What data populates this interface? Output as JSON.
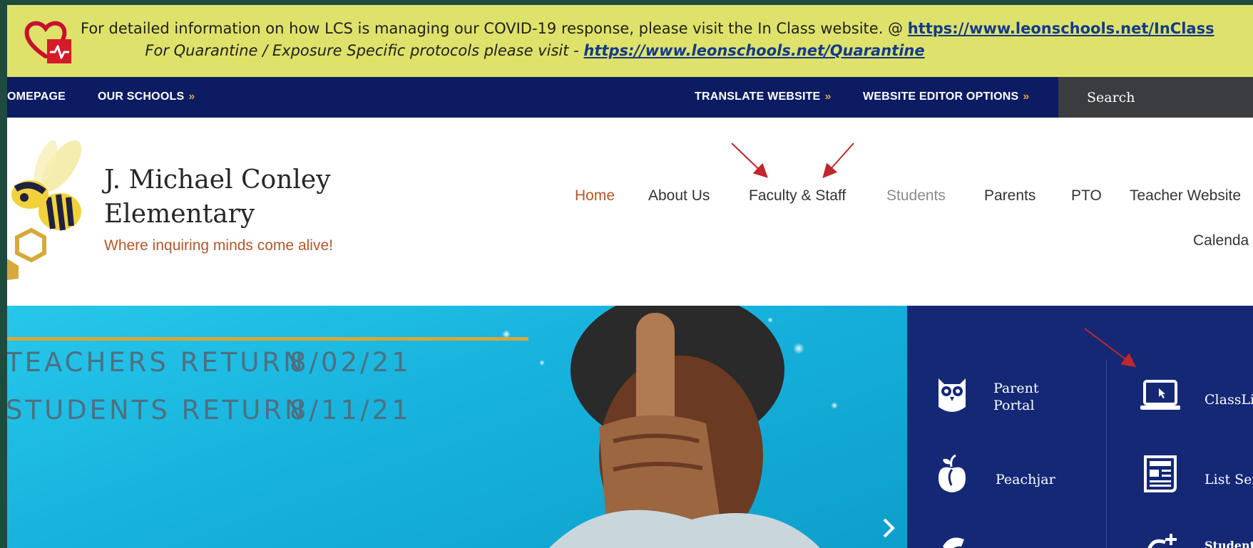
{
  "covid_banner": {
    "line1_text": "For detailed information on how LCS is managing our COVID-19 response, please visit the In Class website. @ ",
    "line1_link": "https://www.leonschools.net/InClass",
    "line2_text": "For Quarantine / Exposure Specific protocols please visit - ",
    "line2_link": "https://www.leonschools.net/Quarantine"
  },
  "utility_nav": {
    "homepage": "OMEPAGE",
    "our_schools": "OUR SCHOOLS",
    "translate": "TRANSLATE WEBSITE",
    "editor_options": "WEBSITE EDITOR OPTIONS",
    "chevron": "»",
    "search_placeholder": "Search"
  },
  "school": {
    "name_line1": "J. Michael Conley",
    "name_line2": "Elementary",
    "tagline": "Where inquiring minds come alive!"
  },
  "main_nav": {
    "home": "Home",
    "about": "About Us",
    "faculty": "Faculty & Staff",
    "students": "Students",
    "parents": "Parents",
    "pto": "PTO",
    "teacher_websites": "Teacher Website",
    "calendar": "Calenda"
  },
  "hero": {
    "line1_label": "TEACHERS RETURN",
    "line1_date": "8/02/21",
    "line2_label": "STUDENTS RETURN",
    "line2_date": "8/11/21"
  },
  "quick_links": {
    "parent_portal_line1": "Parent",
    "parent_portal_line2": "Portal",
    "classlink": "ClassLin",
    "peachjar": "Peachjar",
    "list_serve": "List Serv",
    "student": "Student"
  },
  "colors": {
    "banner": "#dfe26a",
    "utility_nav": "#0b1c63",
    "accent": "#b5562a",
    "quick_links_bg": "#142876",
    "annotation_arrow": "#c0262c"
  }
}
